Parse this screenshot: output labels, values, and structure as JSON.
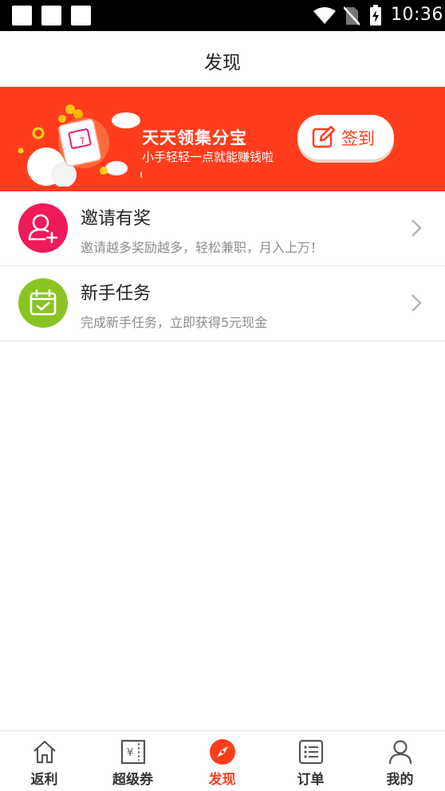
{
  "status_bar": {
    "time": "10:36"
  },
  "header": {
    "title": "发现"
  },
  "banner": {
    "title": "天天领集分宝",
    "subtitle": "小手轻轻一点就能赚钱啦",
    "signin_label": "签到",
    "color": "#ff3d1c"
  },
  "list": [
    {
      "title": "邀请有奖",
      "subtitle": "邀请越多奖励越多，轻松兼职，月入上万！",
      "icon": "add-user-icon",
      "icon_color": "#f0195a"
    },
    {
      "title": "新手任务",
      "subtitle": "完成新手任务，立即获得5元现金",
      "icon": "calendar-check-icon",
      "icon_color": "#8bc323"
    }
  ],
  "bottom_nav": [
    {
      "label": "返利",
      "icon": "home-icon",
      "active": false
    },
    {
      "label": "超级券",
      "icon": "coupon-icon",
      "active": false
    },
    {
      "label": "发现",
      "icon": "compass-icon",
      "active": true
    },
    {
      "label": "订单",
      "icon": "order-list-icon",
      "active": false
    },
    {
      "label": "我的",
      "icon": "user-icon",
      "active": false
    }
  ],
  "colors": {
    "accent": "#ff3d1c",
    "text": "#222222",
    "subtext": "#8c8c8c"
  }
}
